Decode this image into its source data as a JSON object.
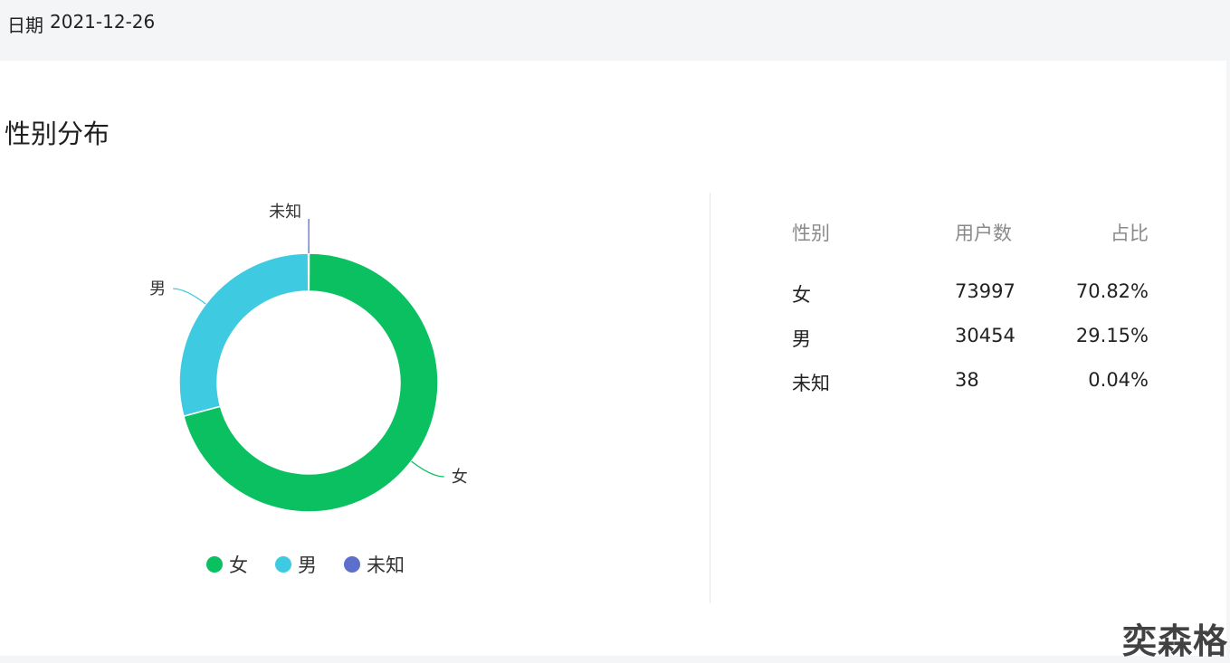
{
  "header": {
    "date_label": "日期：",
    "date_value": "2021-12-26"
  },
  "card": {
    "title": "性别分布"
  },
  "chart_data": {
    "type": "pie",
    "donut": true,
    "title": "",
    "categories": [
      "女",
      "男",
      "未知"
    ],
    "values": [
      73997,
      30454,
      38
    ],
    "colors": [
      "#0ac060",
      "#3ecae0",
      "#5b6fcb"
    ],
    "legend": "bottom",
    "legend_labels": [
      "女",
      "男",
      "未知"
    ]
  },
  "table": {
    "headers": [
      "性别",
      "用户数",
      "占比"
    ],
    "rows": [
      [
        "女",
        "73997",
        "70.82%"
      ],
      [
        "男",
        "30454",
        "29.15%"
      ],
      [
        "未知",
        "38",
        "0.04%"
      ]
    ]
  },
  "watermark": "奕森格"
}
